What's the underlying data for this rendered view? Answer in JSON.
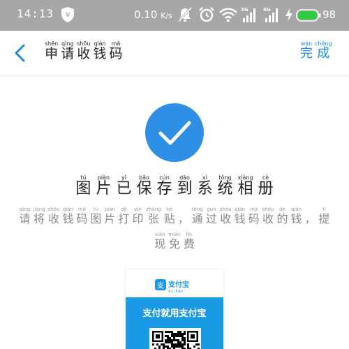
{
  "status_bar": {
    "time": "14:13",
    "shield_glyph": "¥",
    "net_speed": "0.10",
    "net_unit": "K/s",
    "signal1_label": "3G",
    "signal2_label": "4G",
    "battery_pct": "98",
    "battery_color": "#2ecc40"
  },
  "nav": {
    "title": [
      {
        "hz": "申",
        "py": "shēn"
      },
      {
        "hz": "请",
        "py": "qǐng"
      },
      {
        "hz": "收",
        "py": "shōu"
      },
      {
        "hz": "钱",
        "py": "qián"
      },
      {
        "hz": "码",
        "py": "mǎ"
      }
    ],
    "done": [
      {
        "hz": "完",
        "py": "wán"
      },
      {
        "hz": "成",
        "py": "chéng"
      }
    ]
  },
  "success": {
    "title": [
      {
        "hz": "图",
        "py": "tú"
      },
      {
        "hz": "片",
        "py": "piàn"
      },
      {
        "hz": "已",
        "py": "yǐ"
      },
      {
        "hz": "保",
        "py": "bǎo"
      },
      {
        "hz": "存",
        "py": "cún"
      },
      {
        "hz": "到",
        "py": "dào"
      },
      {
        "hz": "系",
        "py": "xì"
      },
      {
        "hz": "统",
        "py": "tǒng"
      },
      {
        "hz": "相",
        "py": "xiàng"
      },
      {
        "hz": "册",
        "py": "cè"
      }
    ],
    "description_line1": [
      {
        "hz": "请",
        "py": "qǐng"
      },
      {
        "hz": "将",
        "py": "jiāng"
      },
      {
        "hz": "收",
        "py": "shōu"
      },
      {
        "hz": "钱",
        "py": "qián"
      },
      {
        "hz": "码",
        "py": "mǎ"
      },
      {
        "hz": "图",
        "py": "tú"
      },
      {
        "hz": "片",
        "py": "piàn"
      },
      {
        "hz": "打",
        "py": "dǎ"
      },
      {
        "hz": "印",
        "py": "yìn"
      },
      {
        "hz": "张",
        "py": "zhāng"
      },
      {
        "hz": "贴",
        "py": "tiē"
      },
      {
        "hz": "，",
        "py": ""
      },
      {
        "hz": "通",
        "py": "tōng"
      },
      {
        "hz": "过",
        "py": "guò"
      },
      {
        "hz": "收",
        "py": "shōu"
      },
      {
        "hz": "钱",
        "py": "qián"
      },
      {
        "hz": "码",
        "py": "mǎ"
      },
      {
        "hz": "收",
        "py": "shōu"
      },
      {
        "hz": "的",
        "py": "de"
      },
      {
        "hz": "钱",
        "py": "qián"
      },
      {
        "hz": "，",
        "py": ""
      },
      {
        "hz": "提",
        "py": "tí"
      }
    ],
    "description_line2": [
      {
        "hz": "现",
        "py": "xiàn"
      },
      {
        "hz": "免",
        "py": "miǎn"
      },
      {
        "hz": "费",
        "py": "fèi"
      }
    ]
  },
  "poster": {
    "logo_text": "支付宝",
    "logo_sub": "ALIPAY",
    "logo_mark": "支",
    "banner_text": "支付就用支付宝",
    "brand_color": "#1a9ae5"
  },
  "colors": {
    "accent": "#1a8ae5",
    "success_circle": "#2d8fe6"
  }
}
